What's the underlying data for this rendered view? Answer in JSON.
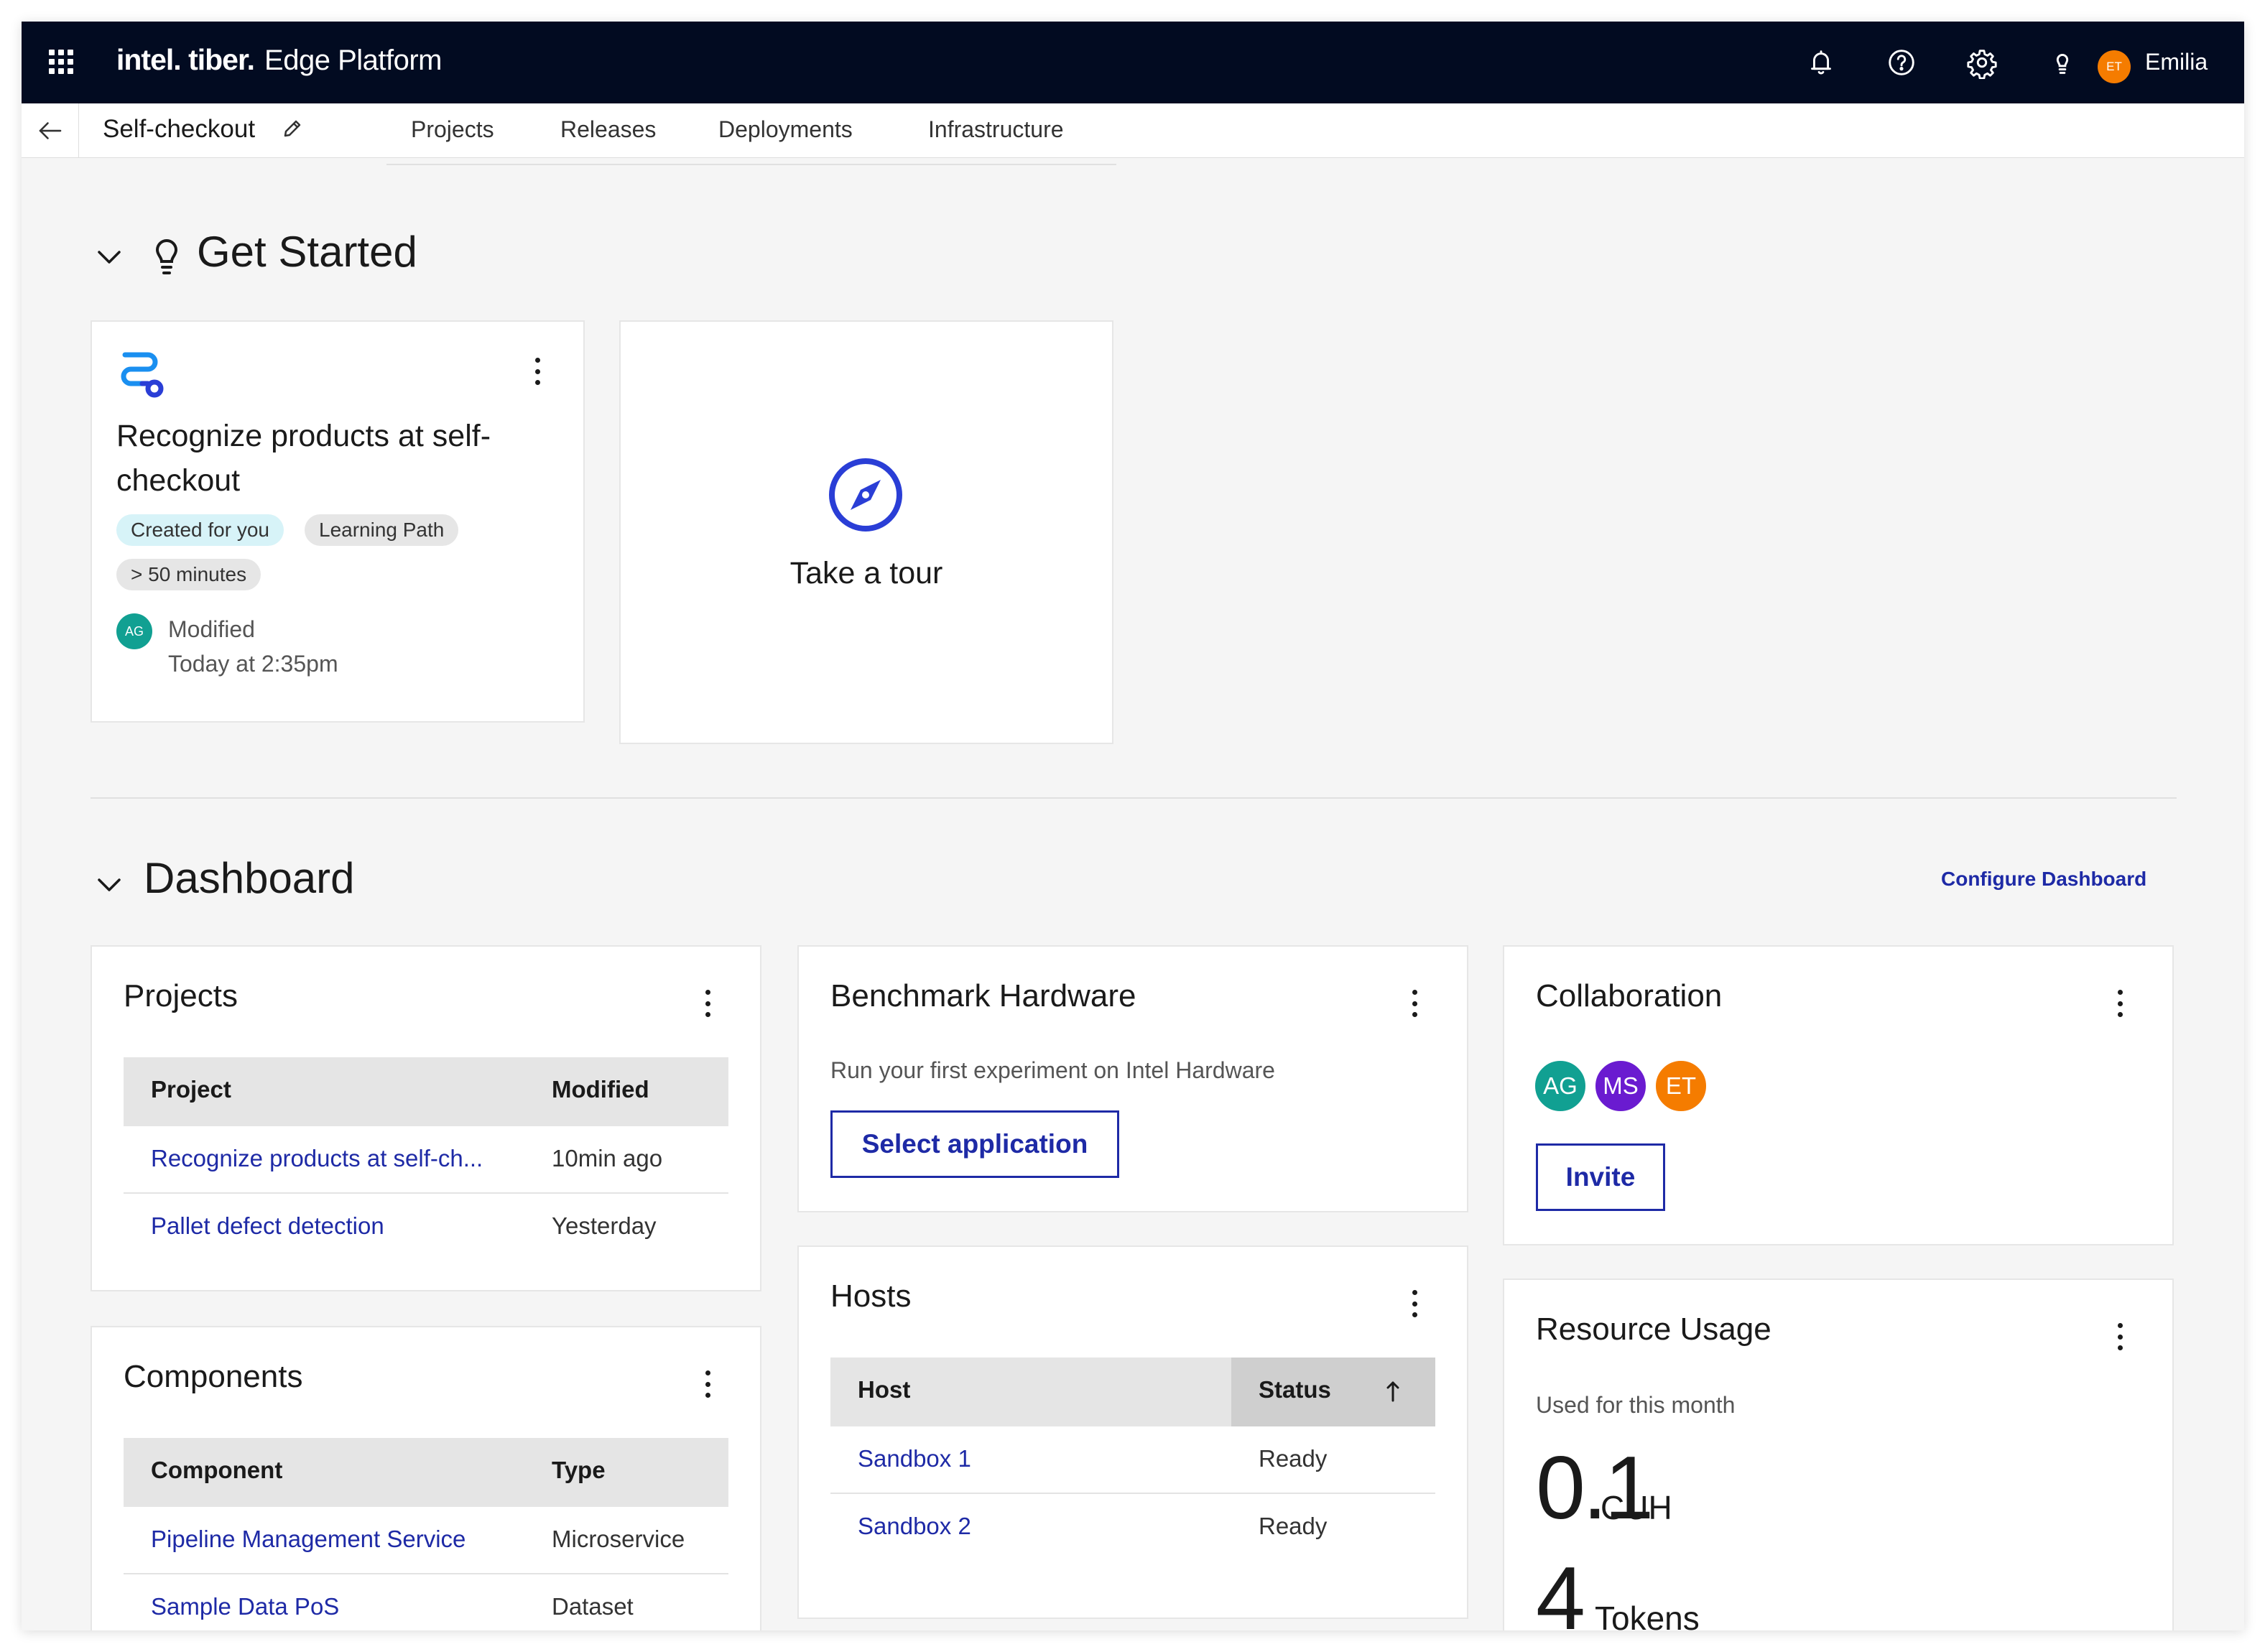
{
  "topbar": {
    "brand_wordmark": "intel. tiber.",
    "brand_product": "Edge Platform",
    "user_initials": "ET",
    "user_name": "Emilia",
    "icons": [
      "grid-menu-icon",
      "bell-icon",
      "help-icon",
      "gear-icon",
      "lightbulb-icon"
    ]
  },
  "subnav": {
    "project_name": "Self-checkout",
    "tabs": [
      "Projects",
      "Releases",
      "Deployments",
      "Infrastructure"
    ]
  },
  "get_started": {
    "title": "Get Started",
    "learning_card": {
      "title": "Recognize products at self-checkout",
      "tags": [
        "Created for you",
        "Learning Path",
        "> 50 minutes"
      ],
      "avatar_initials": "AG",
      "modified_label": "Modified",
      "modified_time": "Today at 2:35pm"
    },
    "tour_card": {
      "label": "Take a tour"
    }
  },
  "dashboard": {
    "title": "Dashboard",
    "configure_link": "Configure Dashboard",
    "projects": {
      "title": "Projects",
      "columns": [
        "Project",
        "Modified"
      ],
      "rows": [
        {
          "name": "Recognize products at self-ch...",
          "modified": "10min ago"
        },
        {
          "name": "Pallet defect detection",
          "modified": "Yesterday"
        }
      ]
    },
    "components": {
      "title": "Components",
      "columns": [
        "Component",
        "Type"
      ],
      "rows": [
        {
          "name": "Pipeline Management Service",
          "type": "Microservice"
        },
        {
          "name": "Sample Data PoS",
          "type": "Dataset"
        }
      ]
    },
    "benchmark": {
      "title": "Benchmark Hardware",
      "description": "Run your first experiment on Intel Hardware",
      "button": "Select application"
    },
    "hosts": {
      "title": "Hosts",
      "columns": [
        "Host",
        "Status"
      ],
      "rows": [
        {
          "name": "Sandbox 1",
          "status": "Ready"
        },
        {
          "name": "Sandbox 2",
          "status": "Ready"
        }
      ]
    },
    "collaboration": {
      "title": "Collaboration",
      "members": [
        {
          "initials": "AG",
          "color": "#11a092"
        },
        {
          "initials": "MS",
          "color": "#6a1bd0"
        },
        {
          "initials": "ET",
          "color": "#f57c00"
        }
      ],
      "button": "Invite"
    },
    "resource_usage": {
      "title": "Resource Usage",
      "label": "Used for this month",
      "cuh_value": "0.1",
      "cuh_unit": "CUH",
      "tokens_value": "4",
      "tokens_unit": "Tokens"
    }
  },
  "colors": {
    "topbar_bg": "#020b21",
    "link_blue": "#1e2aa6",
    "page_bg": "#f5f5f5"
  }
}
